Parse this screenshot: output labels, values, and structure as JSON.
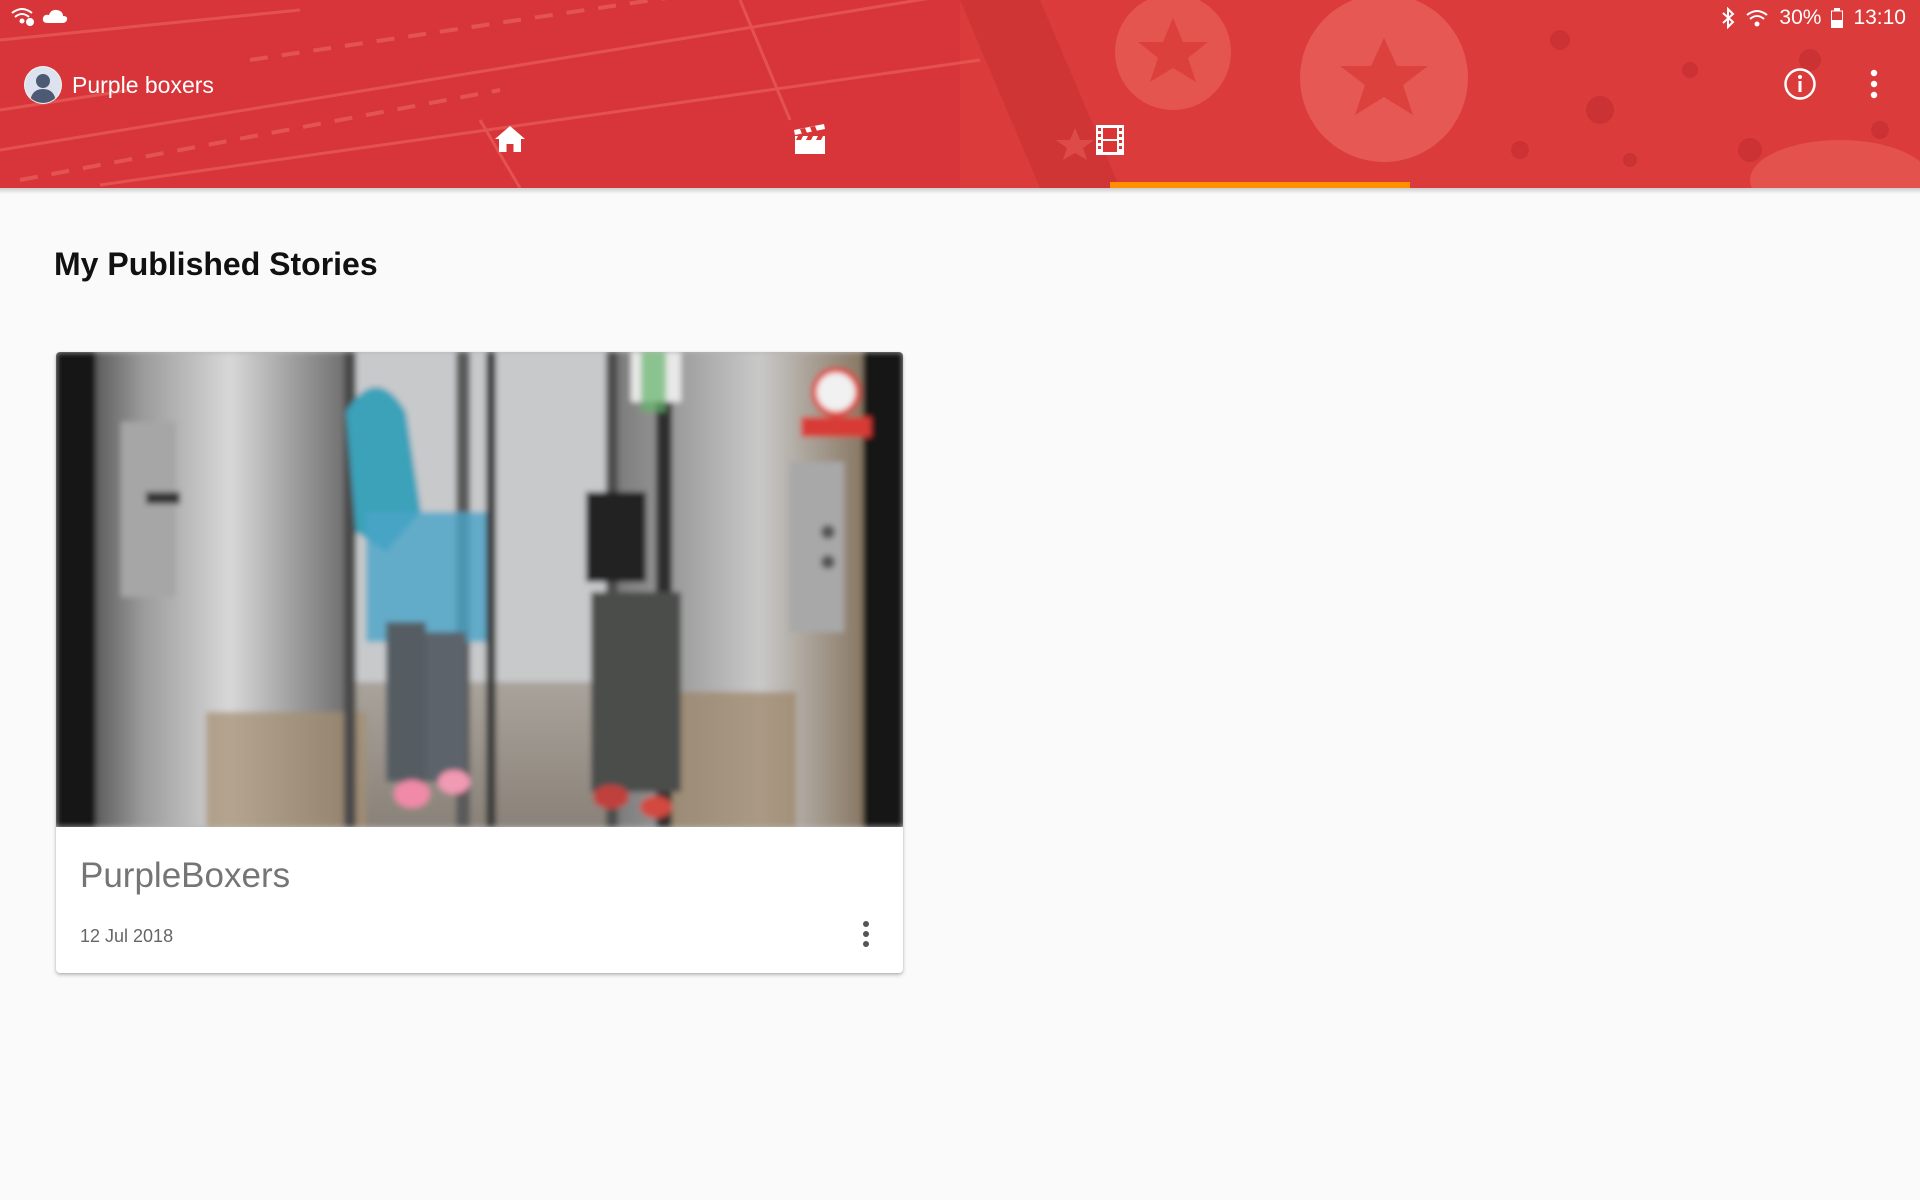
{
  "status_bar": {
    "battery": "30%",
    "time": "13:10"
  },
  "header": {
    "account_name": "Purple boxers",
    "tabs": [
      {
        "name": "home",
        "icon": "home-icon",
        "selected": false
      },
      {
        "name": "create",
        "icon": "clapperboard-icon",
        "selected": false
      },
      {
        "name": "published",
        "icon": "film-icon",
        "selected": true
      }
    ],
    "colors": {
      "primary": "#d93535",
      "indicator": "#ff8f00"
    }
  },
  "main": {
    "title": "My Published Stories",
    "stories": [
      {
        "title": "PurpleBoxers",
        "date": "12 Jul 2018"
      }
    ]
  }
}
